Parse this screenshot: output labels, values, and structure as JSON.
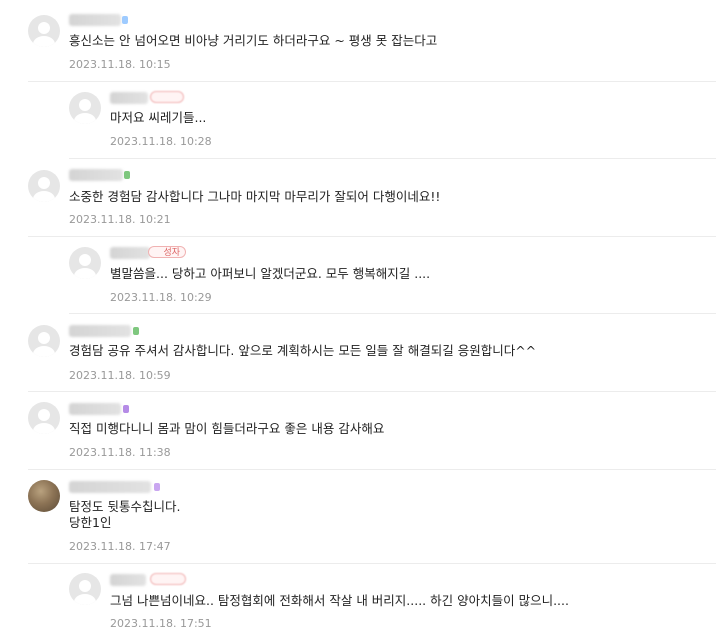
{
  "comments": [
    {
      "text": "흥신소는 안 넘어오면 비아냥 거리기도 하더라구요 ~ 평생 못 잡는다고",
      "date": "2023.11.18. 10:15",
      "dot": "#9ecbff"
    },
    {
      "text": "마저요 씨레기들...",
      "date": "2023.11.18. 10:28"
    },
    {
      "text": "소중한 경험담 감사합니다 그나마 마지막 마무리가 잘되어 다행이네요!!",
      "date": "2023.11.18. 10:21",
      "dot": "#7ec77e"
    },
    {
      "text": "별말씀을... 당하고 아퍼보니 알겠더군요. 모두 행복해지길 ....",
      "date": "2023.11.18. 10:29",
      "author_tag": "성자"
    },
    {
      "text": "경험담 공유 주셔서 감사합니다. 앞으로 계획하시는 모든 일들 잘 해결되길 응원합니다^^",
      "date": "2023.11.18. 10:59",
      "dot": "#7ec77e"
    },
    {
      "text": "직접 미행다니니 몸과 맘이 힘들더라구요 좋은 내용 감사해요",
      "date": "2023.11.18. 11:38",
      "dot": "#b58be6"
    },
    {
      "text": "탐정도 뒷통수칩니다.",
      "text2": "당한1인",
      "date": "2023.11.18. 17:47",
      "dot": "#c9a6f0"
    },
    {
      "text": "그넘 나쁜넘이네요.. 탐정협회에 전화해서 작살 내 버리지..... 하긴 양아치들이 많으니....",
      "date": "2023.11.18. 17:51"
    }
  ]
}
